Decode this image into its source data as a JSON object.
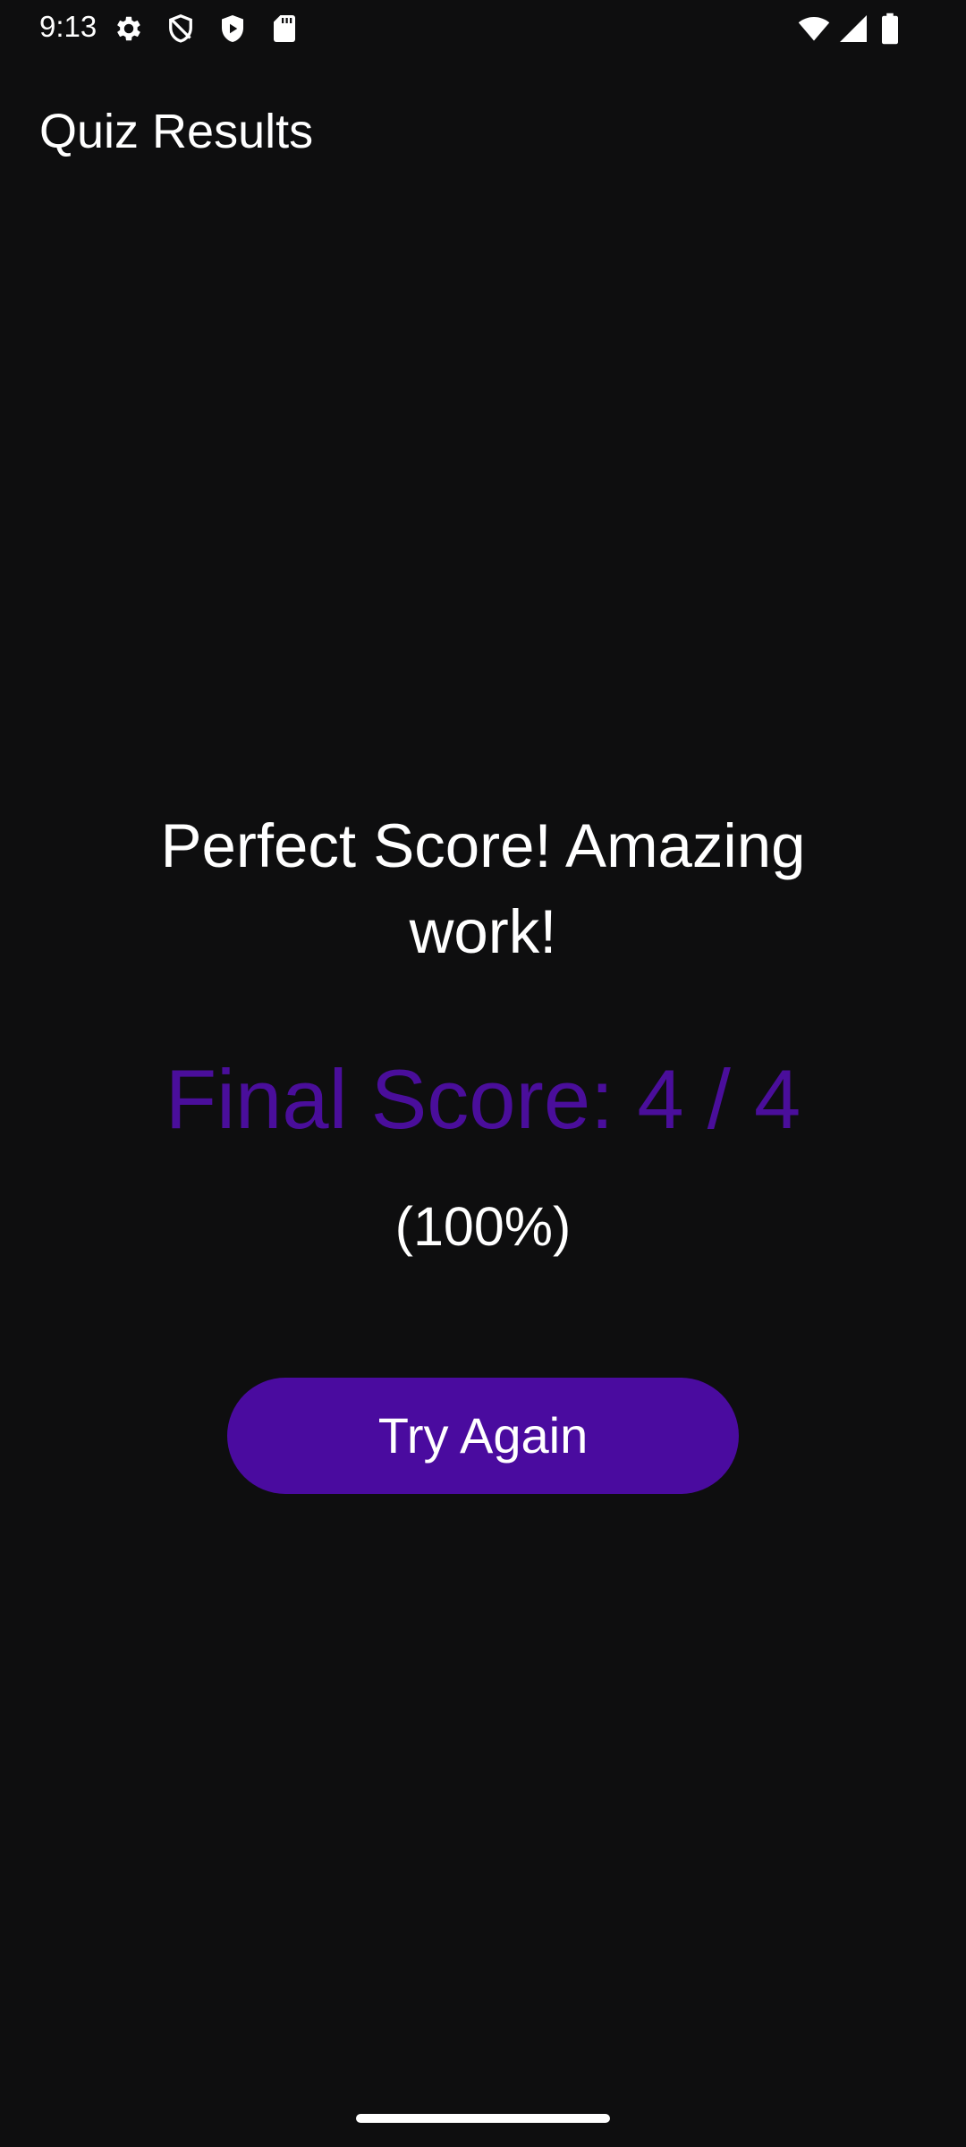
{
  "status_bar": {
    "time": "9:13",
    "left_icons": [
      "gear-icon",
      "shield-outline-icon",
      "shield-play-icon",
      "sd-card-icon"
    ],
    "right_icons": [
      "wifi-icon",
      "cell-signal-icon",
      "battery-icon"
    ]
  },
  "app_bar": {
    "title": "Quiz Results"
  },
  "result": {
    "message": "Perfect Score! Amazing work!",
    "final_score": "Final Score: 4 / 4",
    "percent": "(100%)"
  },
  "actions": {
    "try_again_label": "Try Again"
  },
  "colors": {
    "background": "#0e0e0f",
    "accent": "#4a0e9b",
    "button": "#4a0b9f",
    "text": "#ffffff"
  }
}
